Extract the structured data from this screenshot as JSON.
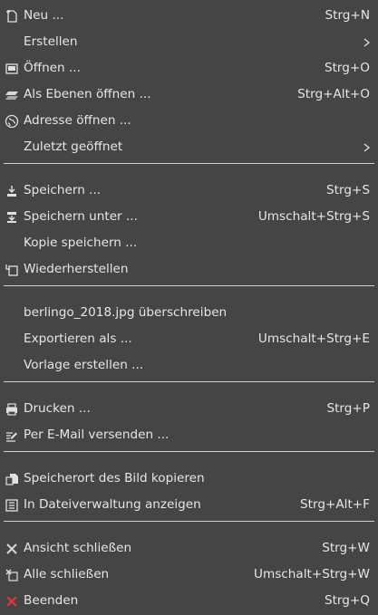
{
  "menu": {
    "items": [
      {
        "label": "Neu ...",
        "shortcut": "Strg+N",
        "icon": "new-document-icon"
      },
      {
        "label": "Erstellen",
        "shortcut": "",
        "icon": "",
        "submenu": true
      },
      {
        "label": "Öffnen ...",
        "shortcut": "Strg+O",
        "icon": "open-folder-icon"
      },
      {
        "label": "Als Ebenen öffnen ...",
        "shortcut": "Strg+Alt+O",
        "icon": "open-as-layers-icon"
      },
      {
        "label": "Adresse öffnen ...",
        "shortcut": "",
        "icon": "globe-icon"
      },
      {
        "label": "Zuletzt geöffnet",
        "shortcut": "",
        "icon": "",
        "submenu": true
      },
      {
        "label": "Speichern ...",
        "shortcut": "Strg+S",
        "icon": "save-icon"
      },
      {
        "label": "Speichern unter ...",
        "shortcut": "Umschalt+Strg+S",
        "icon": "save-as-icon"
      },
      {
        "label": "Kopie speichern ...",
        "shortcut": "",
        "icon": ""
      },
      {
        "label": "Wiederherstellen",
        "shortcut": "",
        "icon": "revert-icon"
      },
      {
        "label": "berlingo_2018.jpg überschreiben",
        "shortcut": "",
        "icon": ""
      },
      {
        "label": "Exportieren als ...",
        "shortcut": "Umschalt+Strg+E",
        "icon": ""
      },
      {
        "label": "Vorlage erstellen ...",
        "shortcut": "",
        "icon": ""
      },
      {
        "label": "Drucken ...",
        "shortcut": "Strg+P",
        "icon": "printer-icon"
      },
      {
        "label": "Per E-Mail versenden ...",
        "shortcut": "",
        "icon": "email-edit-icon"
      },
      {
        "label": "Speicherort des Bild kopieren",
        "shortcut": "",
        "icon": "copy-location-icon"
      },
      {
        "label": "In Dateiverwaltung anzeigen",
        "shortcut": "Strg+Alt+F",
        "icon": "file-manager-icon"
      },
      {
        "label": "Ansicht schließen",
        "shortcut": "Strg+W",
        "icon": "close-icon"
      },
      {
        "label": "Alle schließen",
        "shortcut": "Umschalt+Strg+W",
        "icon": "close-all-icon"
      },
      {
        "label": "Beenden",
        "shortcut": "Strg+Q",
        "icon": "quit-icon"
      }
    ]
  },
  "colors": {
    "background": "#454545",
    "text": "#e6e6e6",
    "separator": "#d0d0d0",
    "quit_accent": "#d13a3a"
  }
}
